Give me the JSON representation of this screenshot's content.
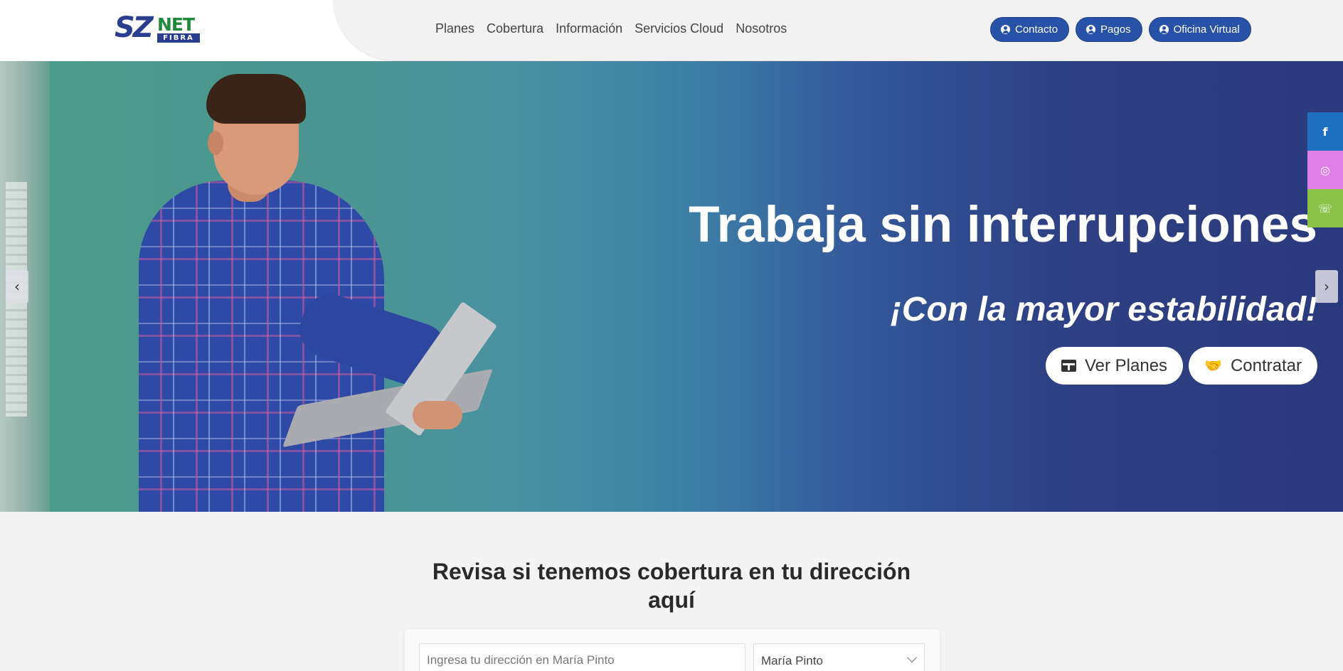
{
  "logo": {
    "sz": "SZ",
    "net": "NET",
    "fibra": "FIBRA"
  },
  "nav": [
    "Planes",
    "Cobertura",
    "Información",
    "Servicios Cloud",
    "Nosotros"
  ],
  "top_buttons": {
    "contacto": "Contacto",
    "pagos": "Pagos",
    "oficina": "Oficina Virtual"
  },
  "hero": {
    "title": "Trabaja sin interrupciones",
    "subtitle": "¡Con la mayor estabilidad!",
    "ver_planes": "Ver Planes",
    "contratar": "Contratar",
    "prev": "‹",
    "next": "›"
  },
  "social": {
    "fb": "f",
    "ig": "◎",
    "wa": "☏"
  },
  "coverage": {
    "title_line1": "Revisa si tenemos cobertura en tu dirección",
    "title_line2": "aquí",
    "address_placeholder": "Ingresa tu dirección en María Pinto",
    "commune_selected": "María Pinto"
  },
  "colors": {
    "brand_blue": "#2752a8",
    "brand_green": "#1f8a3a",
    "facebook": "#1f6fc0",
    "instagram": "#e07fe6",
    "whatsapp": "#8bc34a"
  }
}
